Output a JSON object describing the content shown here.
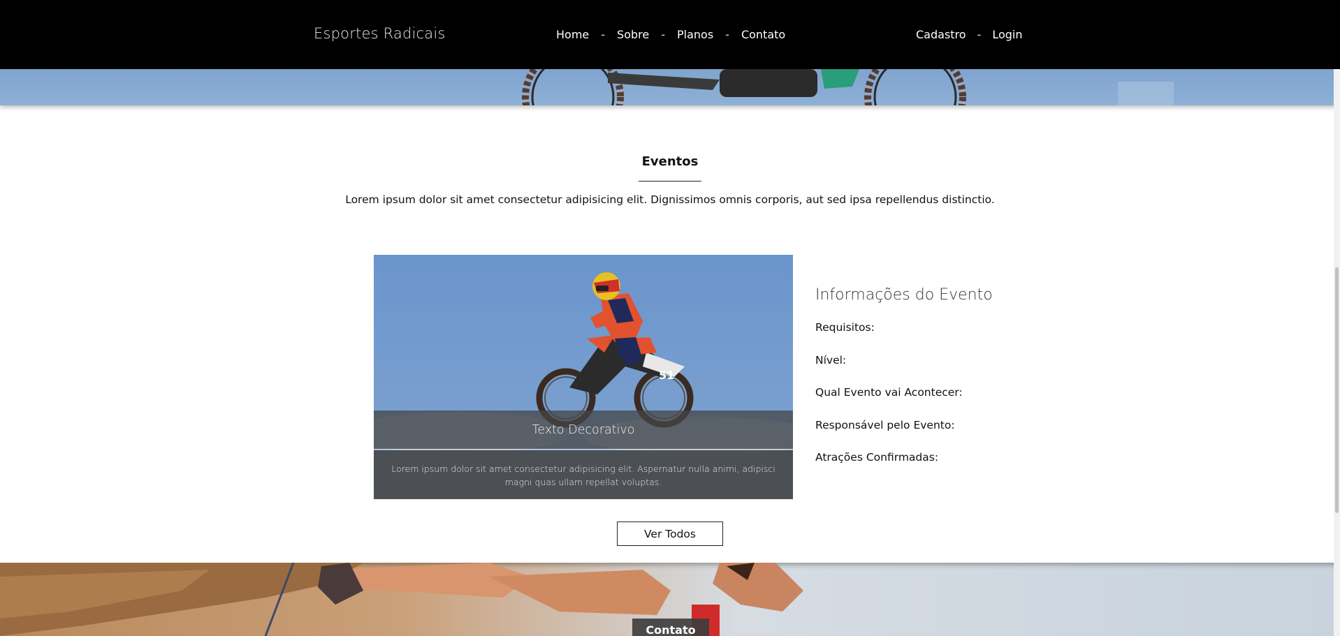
{
  "nav": {
    "brand": "Esportes Radicais",
    "links": [
      "Home",
      "Sobre",
      "Planos",
      "Contato"
    ],
    "separator": "-",
    "auth": [
      "Cadastro",
      "Login"
    ]
  },
  "section": {
    "title": "Eventos",
    "description": "Lorem ipsum dolor sit amet consectetur adipisicing elit. Dignissimos omnis corporis, aut sed ipsa repellendus distinctio."
  },
  "event_card": {
    "caption_title": "Texto Decorativo",
    "caption_text": "Lorem ipsum dolor sit amet consectetur adipisicing elit. Aspernatur nulla animi, adipisci magni quas ullam repellat voluptas.",
    "bike_number": "51"
  },
  "info": {
    "title": "Informações do Evento",
    "items": [
      "Requisitos:",
      "Nível:",
      "Qual Evento vai Acontecer:",
      "Responsável pelo Evento:",
      "Atrações Confirmadas:"
    ]
  },
  "button": {
    "ver_todos": "Ver Todos"
  },
  "bottom_banner": {
    "chip": "Contato"
  },
  "colors": {
    "nav_bg": "#000000",
    "sky": "#6793c8",
    "caption_bg": "#464646"
  }
}
